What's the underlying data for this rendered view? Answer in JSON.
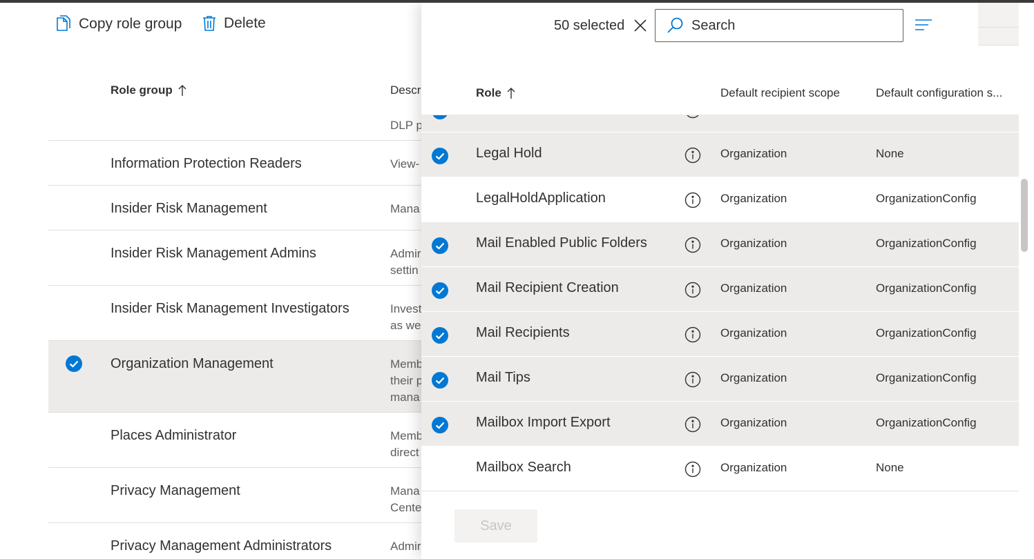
{
  "toolbar": {
    "copy_label": "Copy role group",
    "delete_label": "Delete"
  },
  "left_table": {
    "headers": {
      "name": "Role group",
      "description": "Descr"
    },
    "rows": [
      {
        "name": "",
        "description": "DLP p",
        "selected": false
      },
      {
        "name": "Information Protection Readers",
        "description": "View-",
        "selected": false
      },
      {
        "name": "Insider Risk Management",
        "description": "Mana",
        "selected": false
      },
      {
        "name": "Insider Risk Management Admins",
        "description": "Admir\nsettin",
        "selected": false
      },
      {
        "name": "Insider Risk Management Investigators",
        "description": "Invest\nas we",
        "selected": false
      },
      {
        "name": "Organization Management",
        "description": "Memb\ntheir p\nmana",
        "selected": true
      },
      {
        "name": "Places Administrator",
        "description": "Memb\ndirect",
        "selected": false
      },
      {
        "name": "Privacy Management",
        "description": "Mana\nCente",
        "selected": false
      },
      {
        "name": "Privacy Management Administrators",
        "description": "Admir",
        "selected": false
      }
    ]
  },
  "panel": {
    "selected_count": "50 selected",
    "search_placeholder": "Search",
    "headers": {
      "role": "Role",
      "scope": "Default recipient scope",
      "config": "Default configuration s..."
    },
    "rows": [
      {
        "role": "",
        "scope": "",
        "config": "",
        "selected": true,
        "partial": true
      },
      {
        "role": "Legal Hold",
        "scope": "Organization",
        "config": "None",
        "selected": true
      },
      {
        "role": "LegalHoldApplication",
        "scope": "Organization",
        "config": "OrganizationConfig",
        "selected": false
      },
      {
        "role": "Mail Enabled Public Folders",
        "scope": "Organization",
        "config": "OrganizationConfig",
        "selected": true
      },
      {
        "role": "Mail Recipient Creation",
        "scope": "Organization",
        "config": "OrganizationConfig",
        "selected": true
      },
      {
        "role": "Mail Recipients",
        "scope": "Organization",
        "config": "OrganizationConfig",
        "selected": true
      },
      {
        "role": "Mail Tips",
        "scope": "Organization",
        "config": "OrganizationConfig",
        "selected": true
      },
      {
        "role": "Mailbox Import Export",
        "scope": "Organization",
        "config": "OrganizationConfig",
        "selected": true
      },
      {
        "role": "Mailbox Search",
        "scope": "Organization",
        "config": "None",
        "selected": false
      }
    ],
    "save_label": "Save"
  },
  "colors": {
    "accent": "#0078d4",
    "selected_row": "#edebe9",
    "text": "#323130"
  }
}
